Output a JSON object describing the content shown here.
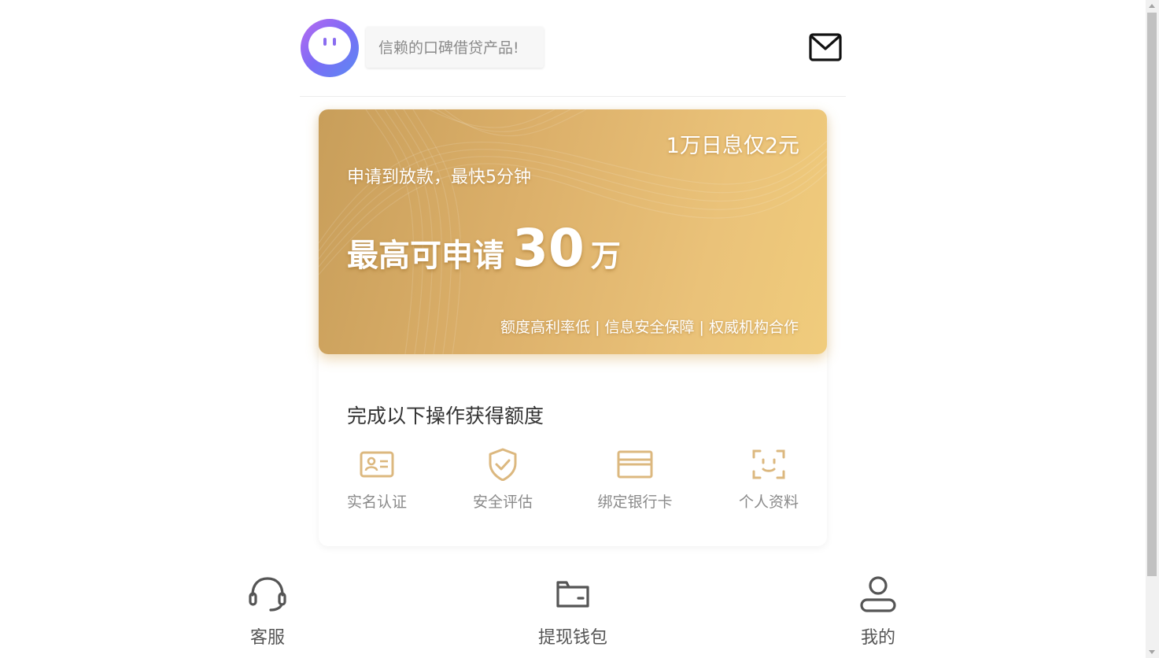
{
  "header": {
    "slogan": "信赖的口碑借贷产品!",
    "avatar_icon": "robot-face-icon",
    "mail_icon": "mail-icon"
  },
  "banner": {
    "rate_text": "1万日息仅2元",
    "speed_text": "申请到放款，最快5分钟",
    "max_label": "最高可申请",
    "max_amount": "30",
    "max_unit": "万",
    "tags": "额度高利率低 | 信息安全保障 | 权威机构合作",
    "colors": {
      "start": "#c89e5a",
      "end": "#f0cc7c"
    }
  },
  "steps": {
    "title": "完成以下操作获得额度",
    "icon_color": "#dcb87f",
    "items": [
      {
        "label": "实名认证",
        "icon": "id-card-icon"
      },
      {
        "label": "安全评估",
        "icon": "shield-check-icon"
      },
      {
        "label": "绑定银行卡",
        "icon": "bank-card-icon"
      },
      {
        "label": "个人资料",
        "icon": "face-scan-icon"
      }
    ]
  },
  "nav": {
    "items": [
      {
        "label": "客服",
        "icon": "headset-icon"
      },
      {
        "label": "提现钱包",
        "icon": "wallet-icon"
      },
      {
        "label": "我的",
        "icon": "user-icon"
      }
    ]
  }
}
